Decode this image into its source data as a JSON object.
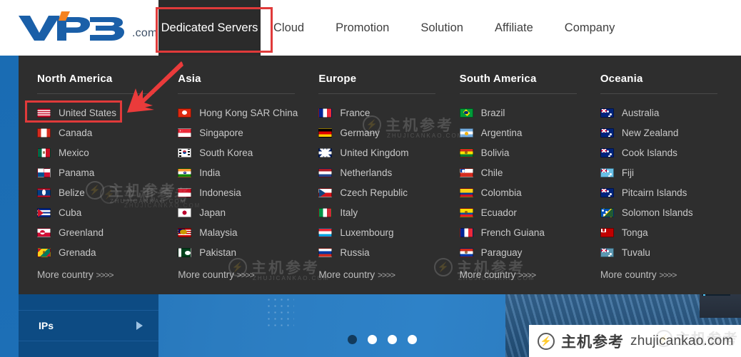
{
  "brand": {
    "logo_text": "VPB",
    "logo_suffix": ".com",
    "logo_color": "#1a5fa8",
    "logo_accent_color": "#f5821f"
  },
  "nav": {
    "items": [
      {
        "label": "Dedicated Servers",
        "active": true
      },
      {
        "label": "Cloud",
        "active": false
      },
      {
        "label": "Promotion",
        "active": false
      },
      {
        "label": "Solution",
        "active": false
      },
      {
        "label": "Affiliate",
        "active": false
      },
      {
        "label": "Company",
        "active": false
      }
    ]
  },
  "highlight": {
    "color": "#e03a3a",
    "nav_target": "Dedicated Servers",
    "menu_target": "United States",
    "arrow": "red-arrow-pointing-to-united-states"
  },
  "mega_menu": {
    "more_label": "More country",
    "more_chevrons": ">>>>",
    "columns": [
      {
        "title": "North America",
        "countries": [
          {
            "name": "United States",
            "flag": "us"
          },
          {
            "name": "Canada",
            "flag": "ca"
          },
          {
            "name": "Mexico",
            "flag": "mx"
          },
          {
            "name": "Panama",
            "flag": "pa"
          },
          {
            "name": "Belize",
            "flag": "bz"
          },
          {
            "name": "Cuba",
            "flag": "cu"
          },
          {
            "name": "Greenland",
            "flag": "gl"
          },
          {
            "name": "Grenada",
            "flag": "gd"
          }
        ]
      },
      {
        "title": "Asia",
        "countries": [
          {
            "name": "Hong Kong SAR China",
            "flag": "hk"
          },
          {
            "name": "Singapore",
            "flag": "sg"
          },
          {
            "name": "South Korea",
            "flag": "kr"
          },
          {
            "name": "India",
            "flag": "in"
          },
          {
            "name": "Indonesia",
            "flag": "id"
          },
          {
            "name": "Japan",
            "flag": "jp"
          },
          {
            "name": "Malaysia",
            "flag": "my"
          },
          {
            "name": "Pakistan",
            "flag": "pk"
          }
        ]
      },
      {
        "title": "Europe",
        "countries": [
          {
            "name": "France",
            "flag": "fr"
          },
          {
            "name": "Germany",
            "flag": "de"
          },
          {
            "name": "United Kingdom",
            "flag": "gb"
          },
          {
            "name": "Netherlands",
            "flag": "nl"
          },
          {
            "name": "Czech Republic",
            "flag": "cz"
          },
          {
            "name": "Italy",
            "flag": "it"
          },
          {
            "name": "Luxembourg",
            "flag": "lu"
          },
          {
            "name": "Russia",
            "flag": "ru"
          }
        ]
      },
      {
        "title": "South America",
        "countries": [
          {
            "name": "Brazil",
            "flag": "br"
          },
          {
            "name": "Argentina",
            "flag": "ar"
          },
          {
            "name": "Bolivia",
            "flag": "bo"
          },
          {
            "name": "Chile",
            "flag": "cl"
          },
          {
            "name": "Colombia",
            "flag": "co"
          },
          {
            "name": "Ecuador",
            "flag": "ec"
          },
          {
            "name": "French Guiana",
            "flag": "gf"
          },
          {
            "name": "Paraguay",
            "flag": "py"
          }
        ]
      },
      {
        "title": "Oceania",
        "countries": [
          {
            "name": "Australia",
            "flag": "au"
          },
          {
            "name": "New Zealand",
            "flag": "nz"
          },
          {
            "name": "Cook Islands",
            "flag": "ck"
          },
          {
            "name": "Fiji",
            "flag": "fj"
          },
          {
            "name": "Pitcairn Islands",
            "flag": "pn"
          },
          {
            "name": "Solomon Islands",
            "flag": "sb"
          },
          {
            "name": "Tonga",
            "flag": "to"
          },
          {
            "name": "Tuvalu",
            "flag": "tv"
          }
        ]
      }
    ]
  },
  "side_panel": {
    "rows": [
      {
        "label": "IPs",
        "icon": "chevron-right-icon"
      }
    ]
  },
  "carousel": {
    "total": 4,
    "active_index": 0
  },
  "watermark": {
    "cn_text": "主机参考",
    "url_text": "zhujicankao.com",
    "url_caps": "ZHUJICANKAO.COM",
    "logo_glyph": "⚡"
  }
}
